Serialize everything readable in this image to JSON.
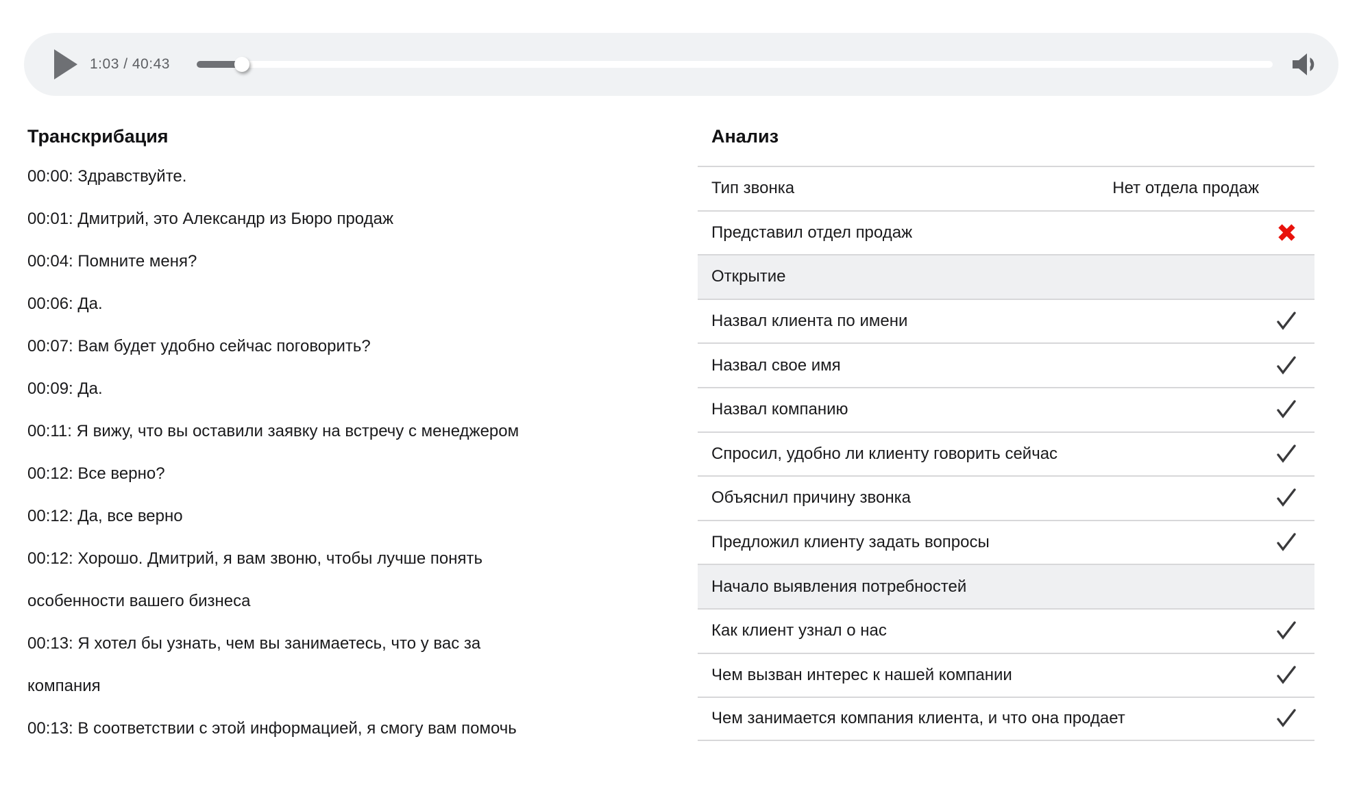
{
  "player": {
    "time_display": "1:03 / 40:43",
    "current_time": "1:03",
    "duration": "40:43",
    "progress_percent": 4.2,
    "play_icon": "play-triangle",
    "volume_icon": "speaker",
    "colors": {
      "background": "#f0f2f4",
      "controls": "#6f7175",
      "track": "#ffffff",
      "time_text": "#5d5f63"
    }
  },
  "transcript": {
    "title": "Транскрибация",
    "entries": [
      {
        "time": "00:00",
        "text": "Здравствуйте."
      },
      {
        "time": "00:01",
        "text": "Дмитрий, это Александр из Бюро продаж"
      },
      {
        "time": "00:04",
        "text": "Помните меня?"
      },
      {
        "time": "00:06",
        "text": "Да."
      },
      {
        "time": "00:07",
        "text": "Вам будет удобно сейчас поговорить?"
      },
      {
        "time": "00:09",
        "text": "Да."
      },
      {
        "time": "00:11",
        "text": "Я вижу, что вы оставили заявку на встречу с менеджером"
      },
      {
        "time": "00:12",
        "text": "Все верно?"
      },
      {
        "time": "00:12",
        "text": "Да, все верно"
      },
      {
        "time": "00:12",
        "text": "Хорошо. Дмитрий, я вам звоню, чтобы лучше понять\nособенности вашего бизнеса"
      },
      {
        "time": "00:13",
        "text": "Я хотел бы узнать, чем вы занимаетесь, что у вас за\nкомпания"
      },
      {
        "time": "00:13",
        "text": "В соответствии с этой информацией, я смогу вам помочь"
      }
    ]
  },
  "analysis": {
    "title": "Анализ",
    "rows": [
      {
        "type": "value",
        "label": "Тип звонка",
        "value": "Нет отдела продаж"
      },
      {
        "type": "cross",
        "label": "Представил отдел продаж"
      },
      {
        "type": "section",
        "label": "Открытие"
      },
      {
        "type": "check",
        "label": "Назвал клиента по имени"
      },
      {
        "type": "check",
        "label": "Назвал свое имя"
      },
      {
        "type": "check",
        "label": "Назвал компанию"
      },
      {
        "type": "check",
        "label": "Спросил, удобно ли клиенту говорить сейчас"
      },
      {
        "type": "check",
        "label": "Объяснил причину звонка"
      },
      {
        "type": "check",
        "label": "Предложил клиенту задать вопросы"
      },
      {
        "type": "section",
        "label": "Начало выявления потребностей"
      },
      {
        "type": "check",
        "label": "Как клиент узнал о нас"
      },
      {
        "type": "check",
        "label": "Чем вызван интерес к нашей компании"
      },
      {
        "type": "check",
        "label": "Чем занимается компания клиента, и что она продает"
      }
    ],
    "colors": {
      "check": "#3a3a3c",
      "cross": "#e8120c",
      "divider": "#d7d7d9",
      "section_bg": "#eff0f2"
    }
  }
}
